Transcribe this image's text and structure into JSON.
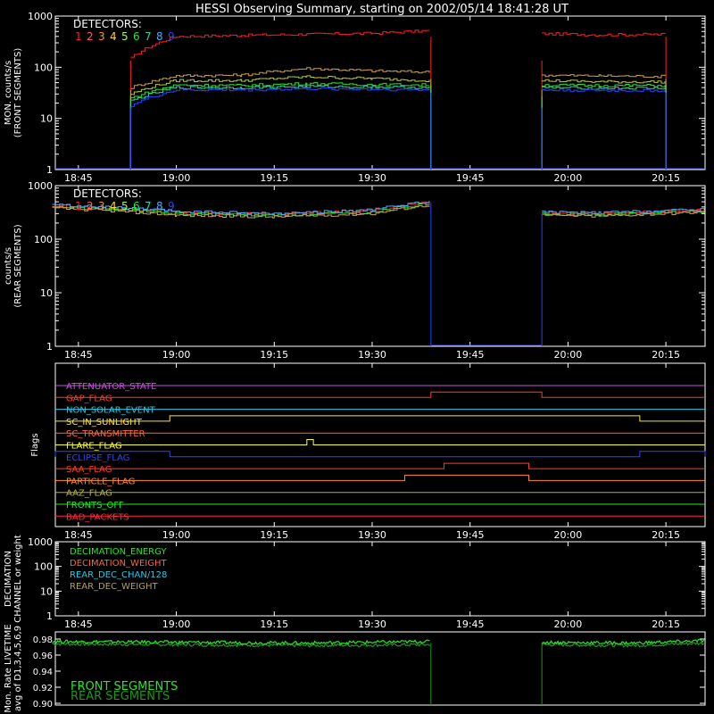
{
  "title": "HESSI Observing Summary, starting on 2002/05/14 18:41:28 UT",
  "time_axis": {
    "range": [
      "18:41:28",
      "20:21:00"
    ],
    "ticks": [
      "18:45",
      "19:00",
      "19:15",
      "19:30",
      "19:45",
      "20:00",
      "20:15"
    ]
  },
  "detectors": {
    "header": "DETECTORS:",
    "labels": [
      "1",
      "2",
      "3",
      "4",
      "5",
      "6",
      "7",
      "8",
      "9"
    ],
    "colors": [
      "#ff2020",
      "#ff5a5a",
      "#ff8c28",
      "#ffd228",
      "#a0ff3c",
      "#28e628",
      "#28d2aa",
      "#50aaff",
      "#2846ff"
    ]
  },
  "chart_data": [
    {
      "type": "line",
      "panel": "front",
      "ylabel": "MON. counts/s (FRONT SEGMENTS)",
      "ylabel_lines": [
        "MON. counts/s",
        "(FRONT SEGMENTS)"
      ],
      "ylog": true,
      "ylim": [
        1,
        1000
      ],
      "yticks": [
        "1",
        "10",
        "100",
        "1000"
      ],
      "data_gaps": [
        [
          "18:41:28",
          "18:53:00"
        ],
        [
          "19:40:00",
          "19:56:00"
        ],
        [
          "20:15:30",
          "20:21:00"
        ]
      ],
      "series": [
        {
          "name": "1",
          "color": "#ff2020",
          "x": [
            "18:53",
            "19:00",
            "19:10",
            "19:20",
            "19:30",
            "19:39",
            "19:56",
            "20:05",
            "20:15"
          ],
          "y": [
            150,
            400,
            420,
            440,
            460,
            520,
            450,
            430,
            440
          ]
        },
        {
          "name": "2",
          "color": "#c8a050",
          "x": [
            "18:53",
            "19:00",
            "19:10",
            "19:20",
            "19:30",
            "19:39",
            "19:56",
            "20:05",
            "20:15"
          ],
          "y": [
            40,
            68,
            70,
            95,
            85,
            80,
            70,
            68,
            66
          ]
        },
        {
          "name": "3",
          "color": "#b4c83c",
          "x": [
            "18:53",
            "19:00",
            "19:10",
            "19:20",
            "19:30",
            "19:39",
            "19:56",
            "20:05",
            "20:15"
          ],
          "y": [
            30,
            55,
            55,
            65,
            60,
            55,
            55,
            52,
            52
          ]
        },
        {
          "name": "4",
          "color": "#28e628",
          "x": [
            "18:53",
            "19:00",
            "19:10",
            "19:20",
            "19:30",
            "19:39",
            "19:56",
            "20:05",
            "20:15"
          ],
          "y": [
            25,
            45,
            44,
            48,
            46,
            45,
            45,
            44,
            44
          ]
        },
        {
          "name": "5",
          "color": "#28d2aa",
          "x": [
            "18:53",
            "19:00",
            "19:10",
            "19:20",
            "19:30",
            "19:39",
            "19:56",
            "20:05",
            "20:15"
          ],
          "y": [
            22,
            40,
            40,
            42,
            41,
            40,
            40,
            39,
            39
          ]
        },
        {
          "name": "6",
          "color": "#2846ff",
          "x": [
            "18:53",
            "19:00",
            "19:10",
            "19:20",
            "19:30",
            "19:39",
            "19:56",
            "20:05",
            "20:15"
          ],
          "y": [
            18,
            36,
            36,
            38,
            37,
            36,
            36,
            35,
            35
          ]
        }
      ]
    },
    {
      "type": "line",
      "panel": "rear",
      "ylabel": "counts/s (REAR SEGMENTS)",
      "ylabel_lines": [
        "counts/s",
        "(REAR SEGMENTS)"
      ],
      "ylog": true,
      "ylim": [
        1,
        1000
      ],
      "yticks": [
        "1",
        "10",
        "100",
        "1000"
      ],
      "data_gaps": [
        [
          "19:40:00",
          "19:56:00"
        ]
      ],
      "series": [
        {
          "name": "1",
          "color": "#ff2020",
          "x": [
            "18:41",
            "18:50",
            "19:00",
            "19:15",
            "19:30",
            "19:39",
            "19:56",
            "20:05",
            "20:21"
          ],
          "y": [
            420,
            380,
            320,
            290,
            340,
            500,
            310,
            300,
            350
          ]
        },
        {
          "name": "5",
          "color": "#28e628",
          "x": [
            "18:41",
            "18:50",
            "19:00",
            "19:15",
            "19:30",
            "19:39",
            "19:56",
            "20:05",
            "20:21"
          ],
          "y": [
            400,
            360,
            300,
            275,
            320,
            470,
            295,
            285,
            335
          ]
        },
        {
          "name": "8",
          "color": "#50aaff",
          "x": [
            "18:41",
            "18:50",
            "19:00",
            "19:15",
            "19:30",
            "19:39",
            "19:56",
            "20:05",
            "20:21"
          ],
          "y": [
            440,
            390,
            330,
            300,
            350,
            520,
            320,
            310,
            360
          ]
        },
        {
          "name": "4",
          "color": "#c8a050",
          "x": [
            "18:41",
            "18:50",
            "19:00",
            "19:15",
            "19:30",
            "19:39",
            "19:56",
            "20:05",
            "20:21"
          ],
          "y": [
            380,
            340,
            280,
            260,
            300,
            440,
            280,
            270,
            320
          ]
        }
      ]
    },
    {
      "type": "line",
      "panel": "flags",
      "ylabel": "Flags",
      "flags": [
        {
          "name": "ATTENUATOR_STATE",
          "color": "#c850dc",
          "changes": []
        },
        {
          "name": "GAP_FLAG",
          "color": "#ff3c28",
          "changes": [
            {
              "on": "19:39",
              "off": "19:56"
            }
          ]
        },
        {
          "name": "NON_SOLAR_EVENT",
          "color": "#28c8e6",
          "changes": []
        },
        {
          "name": "SC_IN_SUNLIGHT",
          "color": "#ffe628",
          "changes": [
            {
              "on": "18:59",
              "off": "20:11"
            }
          ]
        },
        {
          "name": "SC_TRANSMITTER",
          "color": "#ff643c",
          "changes": []
        },
        {
          "name": "FLARE_FLAG",
          "color": "#ffff28",
          "changes": [
            {
              "on": "19:20",
              "off": "19:21"
            }
          ]
        },
        {
          "name": "ECLIPSE_FLAG",
          "color": "#2846ff",
          "changes": [
            {
              "on": "18:41",
              "off": "18:59"
            },
            {
              "on": "20:11",
              "off": "20:21"
            }
          ]
        },
        {
          "name": "SAA_FLAG",
          "color": "#ff3c28",
          "changes": [
            {
              "on": "19:41",
              "off": "19:54"
            }
          ]
        },
        {
          "name": "PARTICLE_FLAG",
          "color": "#ff8c28",
          "changes": [
            {
              "on": "19:35",
              "off": "19:54"
            }
          ]
        },
        {
          "name": "AAZ_FLAG",
          "color": "#b4b428",
          "changes": []
        },
        {
          "name": "FRONTS_OFF",
          "color": "#28e628",
          "changes": []
        },
        {
          "name": "BAD_PACKETS",
          "color": "#ff283c",
          "changes": []
        }
      ]
    },
    {
      "type": "line",
      "panel": "decimation",
      "ylabel": "DECIMATION CHANNEL or weight",
      "ylabel_lines": [
        "DECIMATION",
        "CHANNEL or weight"
      ],
      "ylog": true,
      "ylim": [
        1,
        1000
      ],
      "yticks": [
        "1",
        "10",
        "100",
        "1000"
      ],
      "legend": [
        {
          "name": "DECIMATION_ENERGY",
          "color": "#28e628"
        },
        {
          "name": "DECIMATION_WEIGHT",
          "color": "#ff643c"
        },
        {
          "name": "REAR_DEC_CHAN/128",
          "color": "#28c8e6"
        },
        {
          "name": "REAR_DEC_WEIGHT",
          "color": "#b4a050"
        }
      ],
      "series": []
    },
    {
      "type": "line",
      "panel": "livetime",
      "ylabel": "Mon. Rate LIVETIME avg of D1,3,4,5,6,9",
      "ylabel_lines": [
        "Mon. Rate LIVETIME",
        "avg of D1,3,4,5,6,9"
      ],
      "ylim": [
        0.9,
        0.98
      ],
      "yticks": [
        "0.90",
        "0.92",
        "0.94",
        "0.96",
        "0.98"
      ],
      "data_gaps": [
        [
          "19:40:00",
          "19:56:00"
        ]
      ],
      "legend": [
        {
          "name": "FRONT SEGMENTS",
          "color": "#28e628"
        },
        {
          "name": "REAR SEGMENTS",
          "color": "#1e961e"
        }
      ],
      "series": [
        {
          "name": "FRONT SEGMENTS",
          "color": "#28e628",
          "x": [
            "18:41",
            "19:00",
            "19:20",
            "19:39",
            "19:56",
            "20:10",
            "20:21"
          ],
          "y": [
            0.977,
            0.976,
            0.975,
            0.977,
            0.976,
            0.975,
            0.978
          ]
        },
        {
          "name": "REAR SEGMENTS",
          "color": "#1e961e",
          "x": [
            "18:41",
            "19:00",
            "19:20",
            "19:39",
            "19:56",
            "20:10",
            "20:21"
          ],
          "y": [
            0.974,
            0.973,
            0.972,
            0.973,
            0.973,
            0.972,
            0.975
          ]
        }
      ]
    }
  ]
}
